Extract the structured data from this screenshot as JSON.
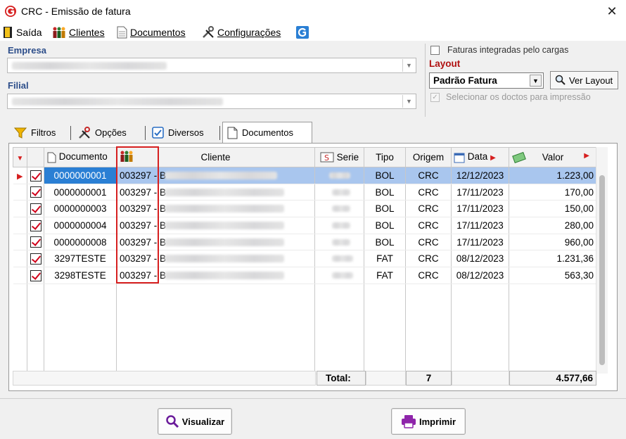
{
  "window": {
    "title": "CRC - Emissão de fatura",
    "close_glyph": "✕"
  },
  "menu": [
    {
      "label": "Saída",
      "icon": "exit-door-icon"
    },
    {
      "label": "Clientes",
      "icon": "clients-people-icon"
    },
    {
      "label": "Documentos",
      "icon": "document-icon"
    },
    {
      "label": "Configurações",
      "icon": "tools-icon"
    },
    {
      "label": "",
      "icon": "g-logo-icon"
    }
  ],
  "empresa": {
    "label": "Empresa"
  },
  "filial": {
    "label": "Filial"
  },
  "options": {
    "faturas_integradas": "Faturas integradas pelo cargas",
    "layout_label": "Layout",
    "layout_value": "Padrão Fatura",
    "ver_layout": "Ver Layout",
    "selecionar_doctos": "Selecionar os doctos para impressão"
  },
  "tabs": [
    {
      "label": "Filtros",
      "icon": "funnel-icon"
    },
    {
      "label": "Opções",
      "icon": "tools-icon"
    },
    {
      "label": "Diversos",
      "icon": "checkbox-icon"
    },
    {
      "label": "Documentos",
      "icon": "document-icon"
    }
  ],
  "grid": {
    "columns": [
      "Documento",
      "Cliente",
      "Serie",
      "Tipo",
      "Origem",
      "Data",
      "Valor"
    ],
    "rows": [
      {
        "documento": "0000000001",
        "cliente": "003297 - B",
        "tipo": "BOL",
        "origem": "CRC",
        "data": "12/12/2023",
        "valor": "1.223,00"
      },
      {
        "documento": "0000000001",
        "cliente": "003297 - B",
        "tipo": "BOL",
        "origem": "CRC",
        "data": "17/11/2023",
        "valor": "170,00"
      },
      {
        "documento": "0000000003",
        "cliente": "003297 - B",
        "tipo": "BOL",
        "origem": "CRC",
        "data": "17/11/2023",
        "valor": "150,00"
      },
      {
        "documento": "0000000004",
        "cliente": "003297 - B",
        "tipo": "BOL",
        "origem": "CRC",
        "data": "17/11/2023",
        "valor": "280,00"
      },
      {
        "documento": "0000000008",
        "cliente": "003297 - B",
        "tipo": "BOL",
        "origem": "CRC",
        "data": "17/11/2023",
        "valor": "960,00"
      },
      {
        "documento": "3297TESTE",
        "cliente": "003297 - B",
        "tipo": "FAT",
        "origem": "CRC",
        "data": "08/12/2023",
        "valor": "1.231,36"
      },
      {
        "documento": "3298TESTE",
        "cliente": "003297 - B",
        "tipo": "FAT",
        "origem": "CRC",
        "data": "08/12/2023",
        "valor": "563,30"
      }
    ],
    "totals": {
      "label": "Total:",
      "count": "7",
      "sum": "4.577,66"
    }
  },
  "buttons": {
    "visualizar": "Visualizar",
    "imprimir": "Imprimir"
  },
  "colors": {
    "accent_red": "#d61f1f",
    "selection_blue": "#a9c6ee",
    "label_blue": "#2d4e8a",
    "layout_red": "#b01010"
  }
}
